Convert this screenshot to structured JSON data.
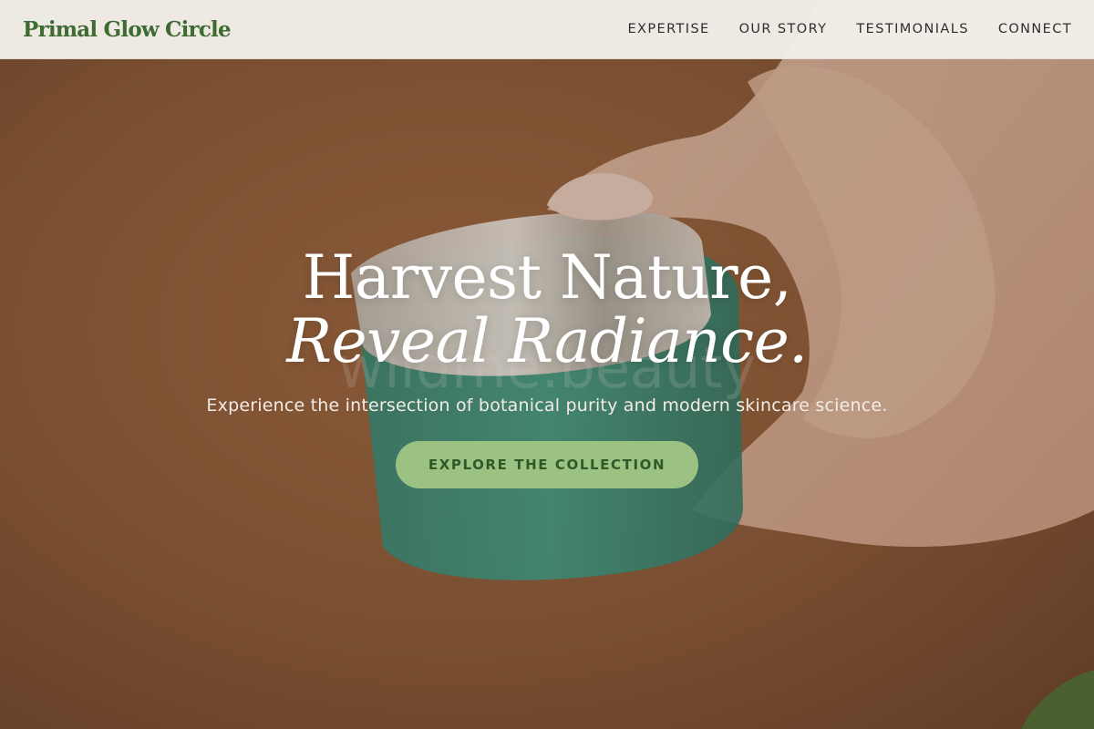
{
  "header": {
    "logo": "Primal Glow Circle",
    "nav": [
      {
        "label": "EXPERTISE"
      },
      {
        "label": "OUR STORY"
      },
      {
        "label": "TESTIMONIALS"
      },
      {
        "label": "CONNECT"
      }
    ]
  },
  "hero": {
    "title_line1": "Harvest Nature,",
    "title_line2": "Reveal Radiance.",
    "subtitle": "Experience the intersection of botanical purity and modern skincare science.",
    "cta_label": "EXPLORE THE COLLECTION",
    "image_watermark": "wildme.beauty"
  },
  "colors": {
    "brand_green": "#3d6b32",
    "cta_background": "#9cc283",
    "header_background": "#f2efe9",
    "hero_background": "#8a5a3a"
  },
  "icons": []
}
